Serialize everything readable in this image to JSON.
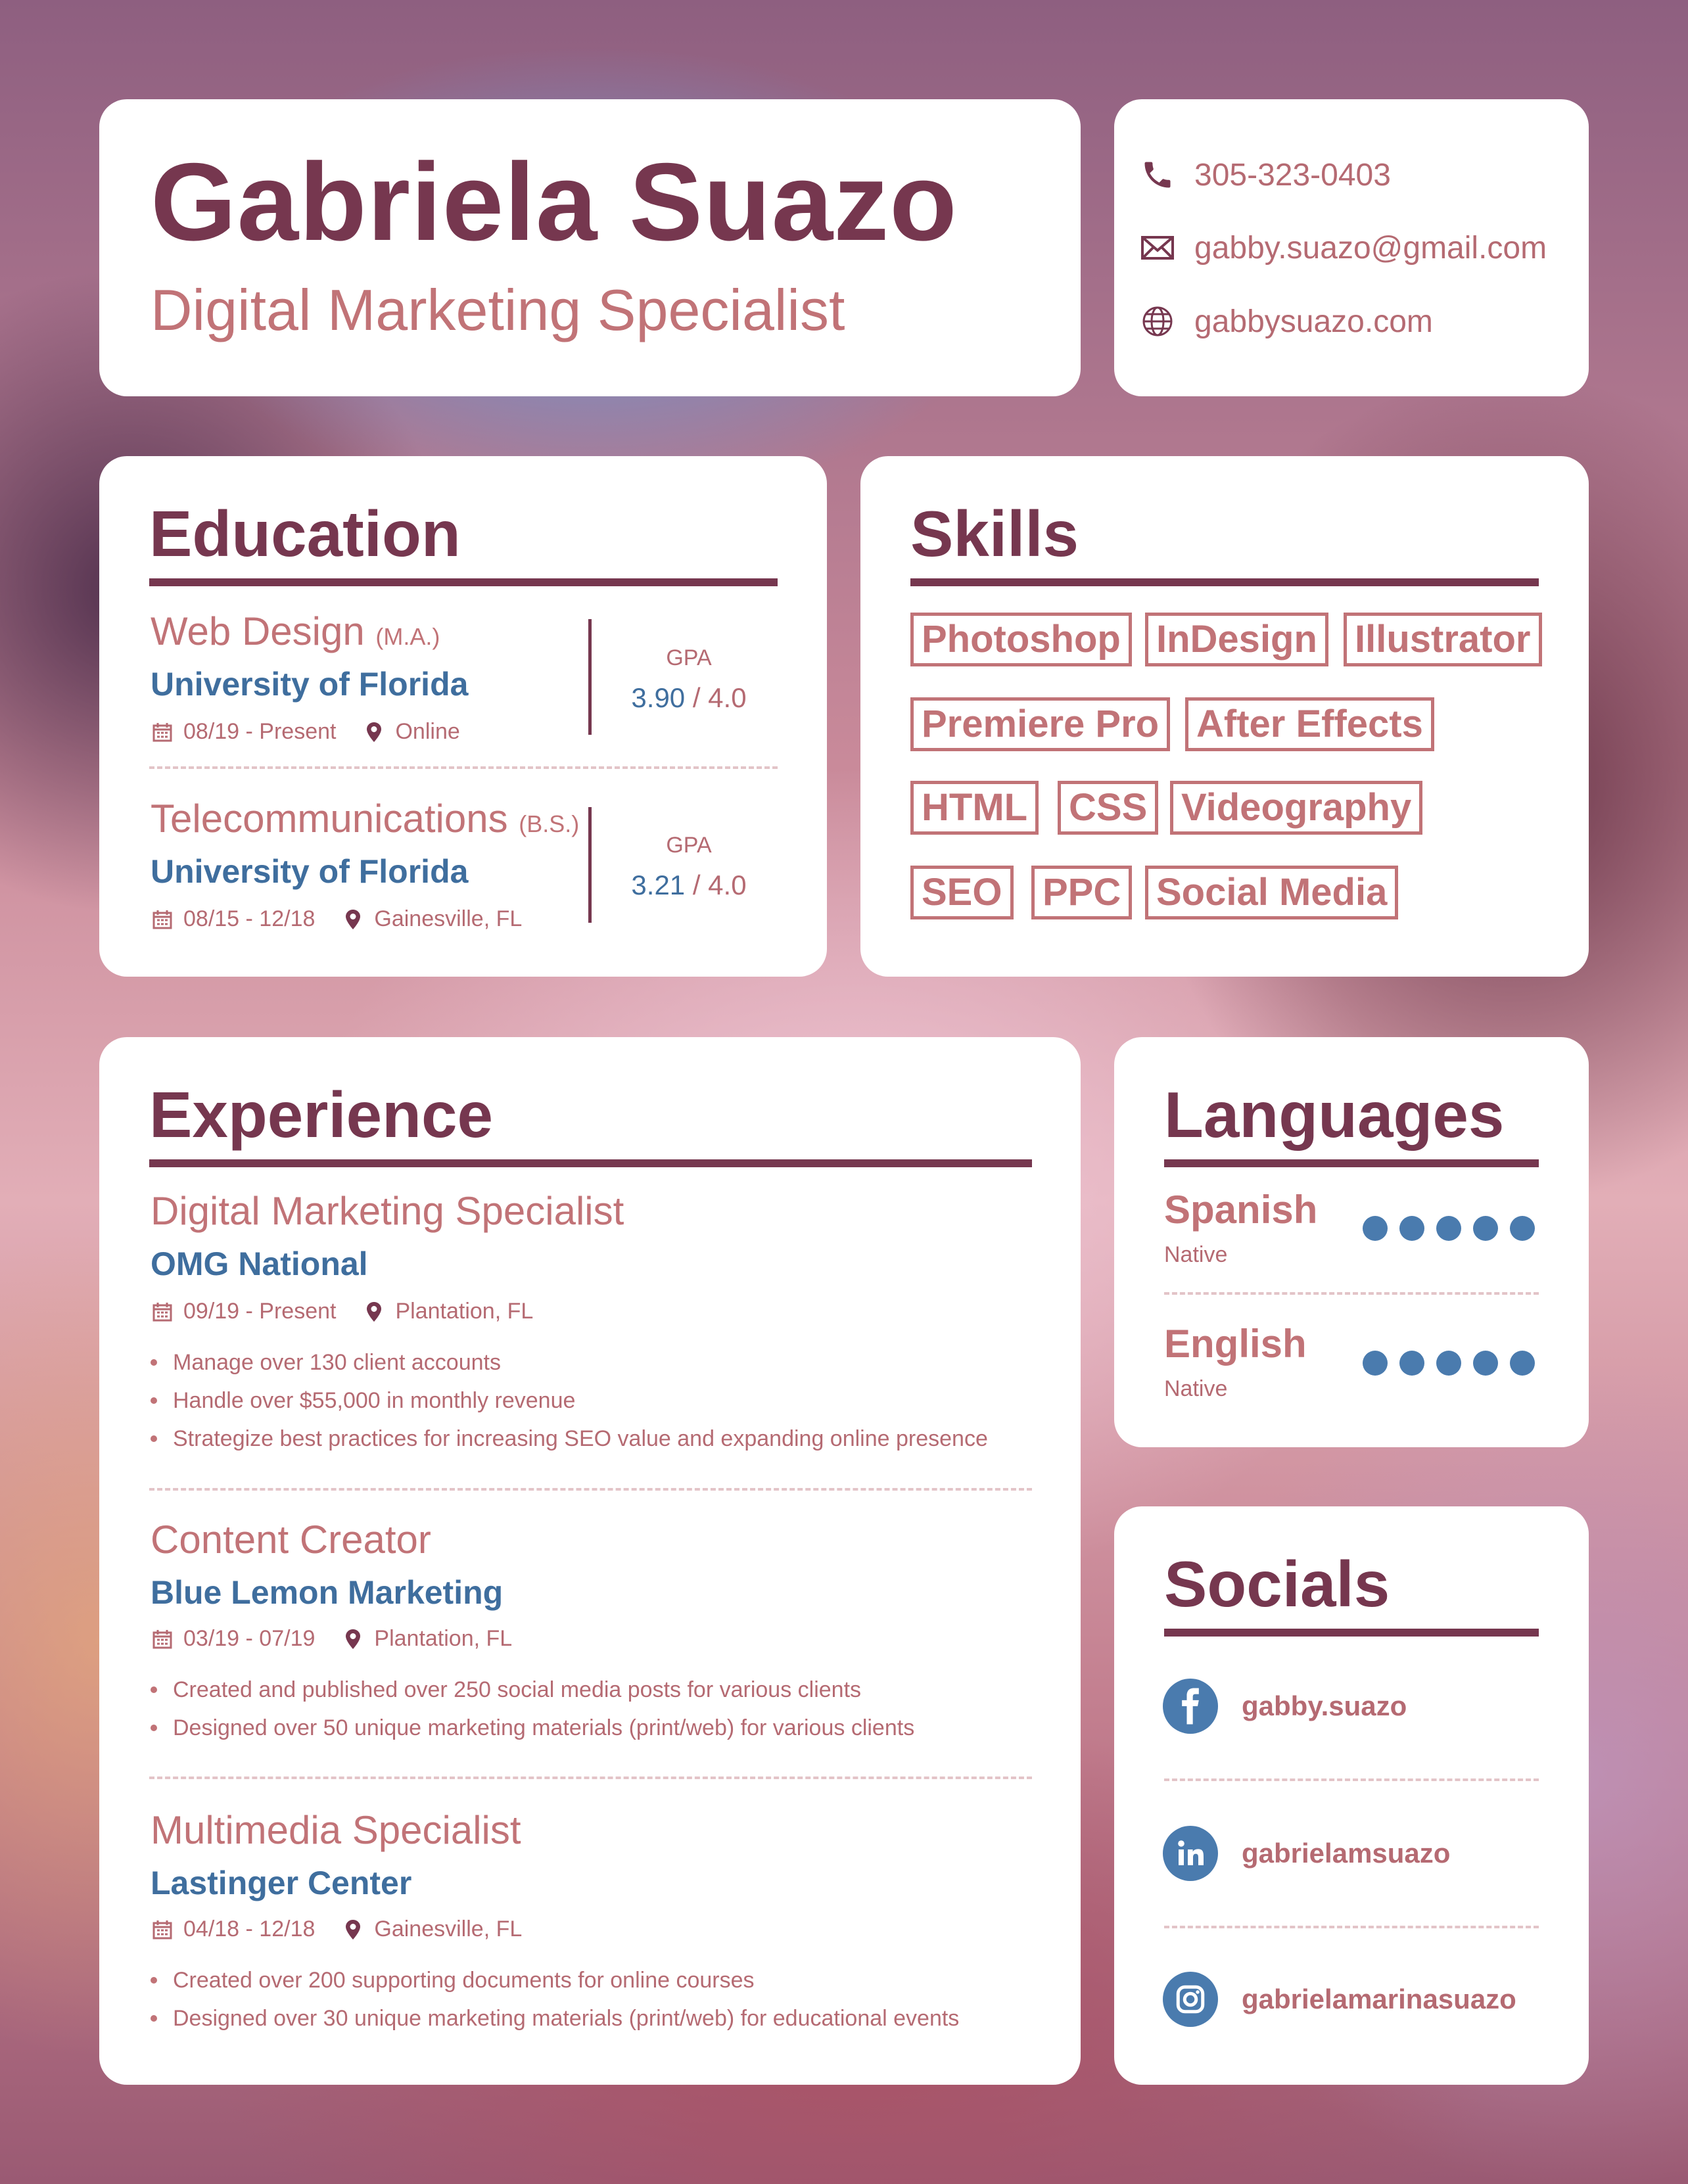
{
  "header": {
    "name": "Gabriela Suazo",
    "title": "Digital Marketing Specialist"
  },
  "contact": {
    "phone": "305-323-0403",
    "email": "gabby.suazo@gmail.com",
    "website": "gabbysuazo.com",
    "icons": [
      "phone-icon",
      "envelope-icon",
      "globe-icon"
    ]
  },
  "education": {
    "heading": "Education",
    "entries": [
      {
        "degree": "Web Design",
        "degree_abbr": "(M.A.)",
        "school": "University of Florida",
        "dates": "08/19 - Present",
        "location": "Online",
        "gpa_label": "GPA",
        "gpa": "3.90",
        "gpa_of": "/ 4.0"
      },
      {
        "degree": "Telecommunications",
        "degree_abbr": "(B.S.)",
        "school": "University of Florida",
        "dates": "08/15 - 12/18",
        "location": "Gainesville, FL",
        "gpa_label": "GPA",
        "gpa": "3.21",
        "gpa_of": "/ 4.0"
      }
    ]
  },
  "skills": {
    "heading": "Skills",
    "items": [
      "Photoshop",
      "InDesign",
      "Illustrator",
      "Premiere Pro",
      "After Effects",
      "HTML",
      "CSS",
      "Videography",
      "SEO",
      "PPC",
      "Social Media"
    ]
  },
  "experience": {
    "heading": "Experience",
    "jobs": [
      {
        "title": "Digital Marketing Specialist",
        "company": "OMG National",
        "dates": "09/19 - Present",
        "location": "Plantation, FL",
        "bullets": [
          "Manage over 130 client accounts",
          "Handle over $55,000 in monthly revenue",
          "Strategize best practices for increasing SEO value and expanding online presence"
        ]
      },
      {
        "title": "Content Creator",
        "company": "Blue Lemon Marketing",
        "dates": "03/19 - 07/19",
        "location": "Plantation, FL",
        "bullets": [
          "Created and published over 250 social media posts for various clients",
          "Designed over 50 unique marketing materials (print/web) for various clients"
        ]
      },
      {
        "title": "Multimedia Specialist",
        "company": "Lastinger Center",
        "dates": "04/18 - 12/18",
        "location": "Gainesville, FL",
        "bullets": [
          "Created over 200 supporting documents for online courses",
          "Designed over 30 unique marketing materials (print/web) for educational events"
        ]
      }
    ]
  },
  "languages": {
    "heading": "Languages",
    "items": [
      {
        "name": "Spanish",
        "level": "Native",
        "rating": 5,
        "max": 5
      },
      {
        "name": "English",
        "level": "Native",
        "rating": 5,
        "max": 5
      }
    ]
  },
  "socials": {
    "heading": "Socials",
    "items": [
      {
        "network": "facebook-icon",
        "handle": "gabby.suazo"
      },
      {
        "network": "linkedin-icon",
        "handle": "gabrielamsuazo"
      },
      {
        "network": "instagram-icon",
        "handle": "gabrielamarinasuazo"
      }
    ]
  },
  "colors": {
    "plum": "#76374f",
    "rose": "#c17377",
    "blue": "#3f6e9e",
    "dot_blue": "#4a7bae",
    "card": "#ffffff"
  }
}
